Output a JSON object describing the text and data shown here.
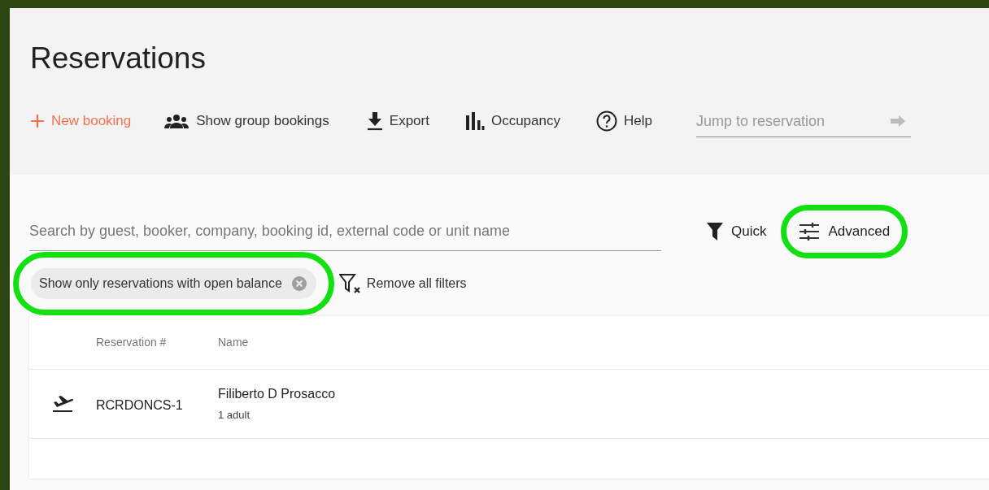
{
  "page": {
    "title": "Reservations"
  },
  "toolbar": [
    {
      "kind": "new",
      "label": "New booking"
    },
    {
      "kind": "group",
      "label": "Show group bookings"
    },
    {
      "kind": "export",
      "label": "Export"
    },
    {
      "kind": "occupancy",
      "label": "Occupancy"
    },
    {
      "kind": "help",
      "label": "Help"
    }
  ],
  "jump_field": {
    "placeholder": "Jump to reservation"
  },
  "search": {
    "placeholder": "Search by guest, booker, company, booking id, external code or unit name"
  },
  "filter_modes": [
    {
      "kind": "quick",
      "label": "Quick",
      "highlighted": false
    },
    {
      "kind": "advanced",
      "label": "Advanced",
      "highlighted": true
    }
  ],
  "active_filters": [
    {
      "label": "Show only reservations with open balance",
      "highlighted": true
    }
  ],
  "remove_filters": "Remove all filters",
  "table": {
    "columns": [
      "Reservation #",
      "Name"
    ],
    "rows": [
      {
        "kind": "departure",
        "number": "RCRDONCS-1",
        "name": "Filiberto D Prosacco",
        "guests": "1 adult"
      }
    ]
  }
}
